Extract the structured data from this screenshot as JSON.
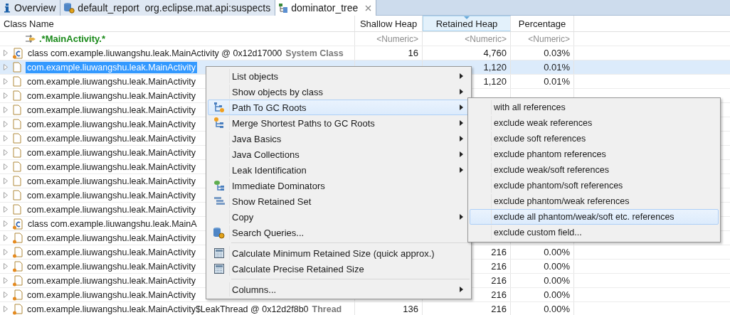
{
  "tabs": [
    {
      "label": "Overview",
      "kind": "info",
      "selected": false,
      "closable": false
    },
    {
      "label": "default_report  org.eclipse.mat.api:suspects",
      "kind": "report",
      "selected": false,
      "closable": false
    },
    {
      "label": "dominator_tree",
      "kind": "tree",
      "selected": true,
      "closable": true
    }
  ],
  "table": {
    "columns": [
      {
        "label": "Class Name",
        "sorted": false
      },
      {
        "label": "Shallow Heap",
        "sorted": false
      },
      {
        "label": "Retained Heap",
        "sorted": true
      },
      {
        "label": "Percentage",
        "sorted": false
      }
    ],
    "filters": [
      ".*MainActivity.*",
      "<Numeric>",
      "<Numeric>",
      "<Numeric>"
    ],
    "rows": [
      {
        "kind": "class",
        "name": "class com.example.liuwangshu.leak.MainActivity @ 0x12d17000",
        "tag": "System Class",
        "shallow": "16",
        "retained": "4,760",
        "percentage": "0.03%",
        "selected": false
      },
      {
        "kind": "object",
        "name": "com.example.liuwangshu.leak.MainActivity",
        "retained": "1,120",
        "percentage": "0.01%",
        "selected": true
      },
      {
        "kind": "object",
        "name": "com.example.liuwangshu.leak.MainActivity",
        "retained": "1,120",
        "percentage": "0.01%",
        "selected": false
      },
      {
        "kind": "object",
        "name": "com.example.liuwangshu.leak.MainActivity",
        "selected": false
      },
      {
        "kind": "object",
        "name": "com.example.liuwangshu.leak.MainActivity",
        "selected": false
      },
      {
        "kind": "object",
        "name": "com.example.liuwangshu.leak.MainActivity",
        "selected": false
      },
      {
        "kind": "object",
        "name": "com.example.liuwangshu.leak.MainActivity",
        "selected": false
      },
      {
        "kind": "object",
        "name": "com.example.liuwangshu.leak.MainActivity",
        "selected": false
      },
      {
        "kind": "object",
        "name": "com.example.liuwangshu.leak.MainActivity",
        "selected": false
      },
      {
        "kind": "object",
        "name": "com.example.liuwangshu.leak.MainActivity",
        "selected": false
      },
      {
        "kind": "object",
        "name": "com.example.liuwangshu.leak.MainActivity",
        "selected": false
      },
      {
        "kind": "object",
        "name": "com.example.liuwangshu.leak.MainActivity",
        "selected": false
      },
      {
        "kind": "class",
        "name": "class com.example.liuwangshu.leak.MainA",
        "selected": false
      },
      {
        "kind": "object_ref",
        "name": "com.example.liuwangshu.leak.MainActivity",
        "selected": false
      },
      {
        "kind": "object_ref",
        "name": "com.example.liuwangshu.leak.MainActivity",
        "retained": "216",
        "percentage": "0.00%",
        "selected": false
      },
      {
        "kind": "object_ref",
        "name": "com.example.liuwangshu.leak.MainActivity",
        "retained": "216",
        "percentage": "0.00%",
        "selected": false
      },
      {
        "kind": "object_ref",
        "name": "com.example.liuwangshu.leak.MainActivity",
        "retained": "216",
        "percentage": "0.00%",
        "selected": false
      },
      {
        "kind": "object_ref",
        "name": "com.example.liuwangshu.leak.MainActivity",
        "retained": "216",
        "percentage": "0.00%",
        "selected": false
      },
      {
        "kind": "object_ref",
        "name": "com.example.liuwangshu.leak.MainActivity$LeakThread @ 0x12d2f8b0",
        "tag": "Thread",
        "shallow": "136",
        "retained": "216",
        "percentage": "0.00%",
        "selected": false
      }
    ]
  },
  "context_menu": {
    "groups": [
      [
        {
          "label": "List objects",
          "kind": "plain",
          "submenu": true,
          "selected": false
        },
        {
          "label": "Show objects by class",
          "kind": "plain",
          "submenu": true,
          "selected": false
        },
        {
          "label": "Path To GC Roots",
          "kind": "path",
          "submenu": true,
          "selected": true
        },
        {
          "label": "Merge Shortest Paths to GC Roots",
          "kind": "merge",
          "submenu": true,
          "selected": false
        },
        {
          "label": "Java Basics",
          "kind": "plain",
          "submenu": true,
          "selected": false
        },
        {
          "label": "Java Collections",
          "kind": "plain",
          "submenu": true,
          "selected": false
        },
        {
          "label": "Leak Identification",
          "kind": "plain",
          "submenu": true,
          "selected": false
        },
        {
          "label": "Immediate Dominators",
          "kind": "dominators",
          "submenu": false,
          "selected": false
        },
        {
          "label": "Show Retained Set",
          "kind": "retained",
          "submenu": false,
          "selected": false
        },
        {
          "label": "Copy",
          "kind": "plain",
          "submenu": true,
          "selected": false
        },
        {
          "label": "Search Queries...",
          "kind": "search",
          "submenu": false,
          "selected": false
        }
      ],
      [
        {
          "label": "Calculate Minimum Retained Size (quick approx.)",
          "kind": "calc",
          "submenu": false,
          "selected": false
        },
        {
          "label": "Calculate Precise Retained Size",
          "kind": "calc",
          "submenu": false,
          "selected": false
        }
      ],
      [
        {
          "label": "Columns...",
          "kind": "plain",
          "submenu": true,
          "selected": false
        }
      ]
    ]
  },
  "submenu": {
    "items": [
      {
        "label": "with all references",
        "selected": false
      },
      {
        "label": "exclude weak references",
        "selected": false
      },
      {
        "label": "exclude soft references",
        "selected": false
      },
      {
        "label": "exclude phantom references",
        "selected": false
      },
      {
        "label": "exclude weak/soft references",
        "selected": false
      },
      {
        "label": "exclude phantom/soft references",
        "selected": false
      },
      {
        "label": "exclude phantom/weak references",
        "selected": false
      },
      {
        "label": "exclude all phantom/weak/soft etc. references",
        "selected": true
      },
      {
        "label": "exclude custom field...",
        "selected": false
      }
    ]
  }
}
